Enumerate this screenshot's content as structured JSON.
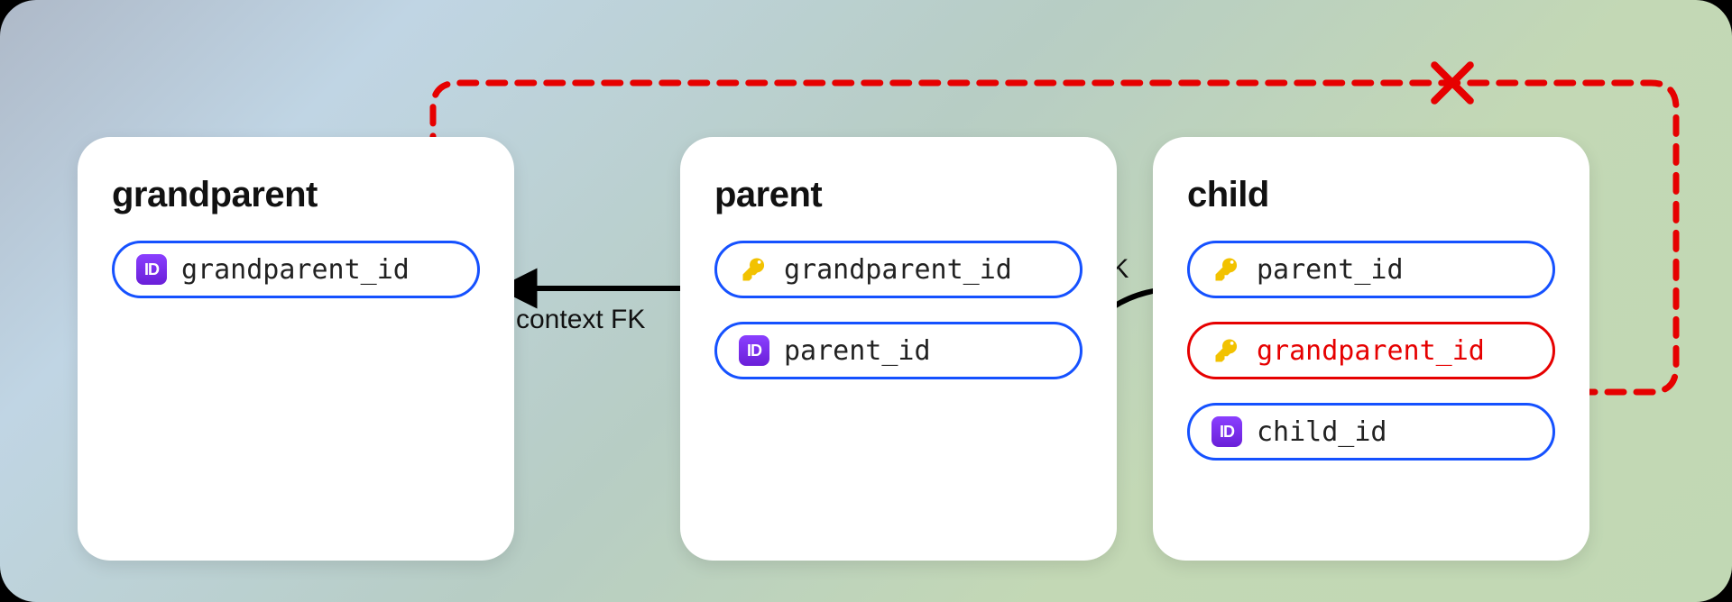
{
  "cards": {
    "grandparent": {
      "title": "grandparent",
      "field_id": "grandparent_id"
    },
    "parent": {
      "title": "parent",
      "field_fk": "grandparent_id",
      "field_id": "parent_id"
    },
    "child": {
      "title": "child",
      "field_fk1": "parent_id",
      "field_fk2": "grandparent_id",
      "field_id": "child_id"
    }
  },
  "edges": {
    "parent_to_grandparent": "context FK",
    "child_to_parent": "context FK"
  },
  "colors": {
    "field_border": "#1551ff",
    "error": "#e60000",
    "arrow": "#000000"
  }
}
